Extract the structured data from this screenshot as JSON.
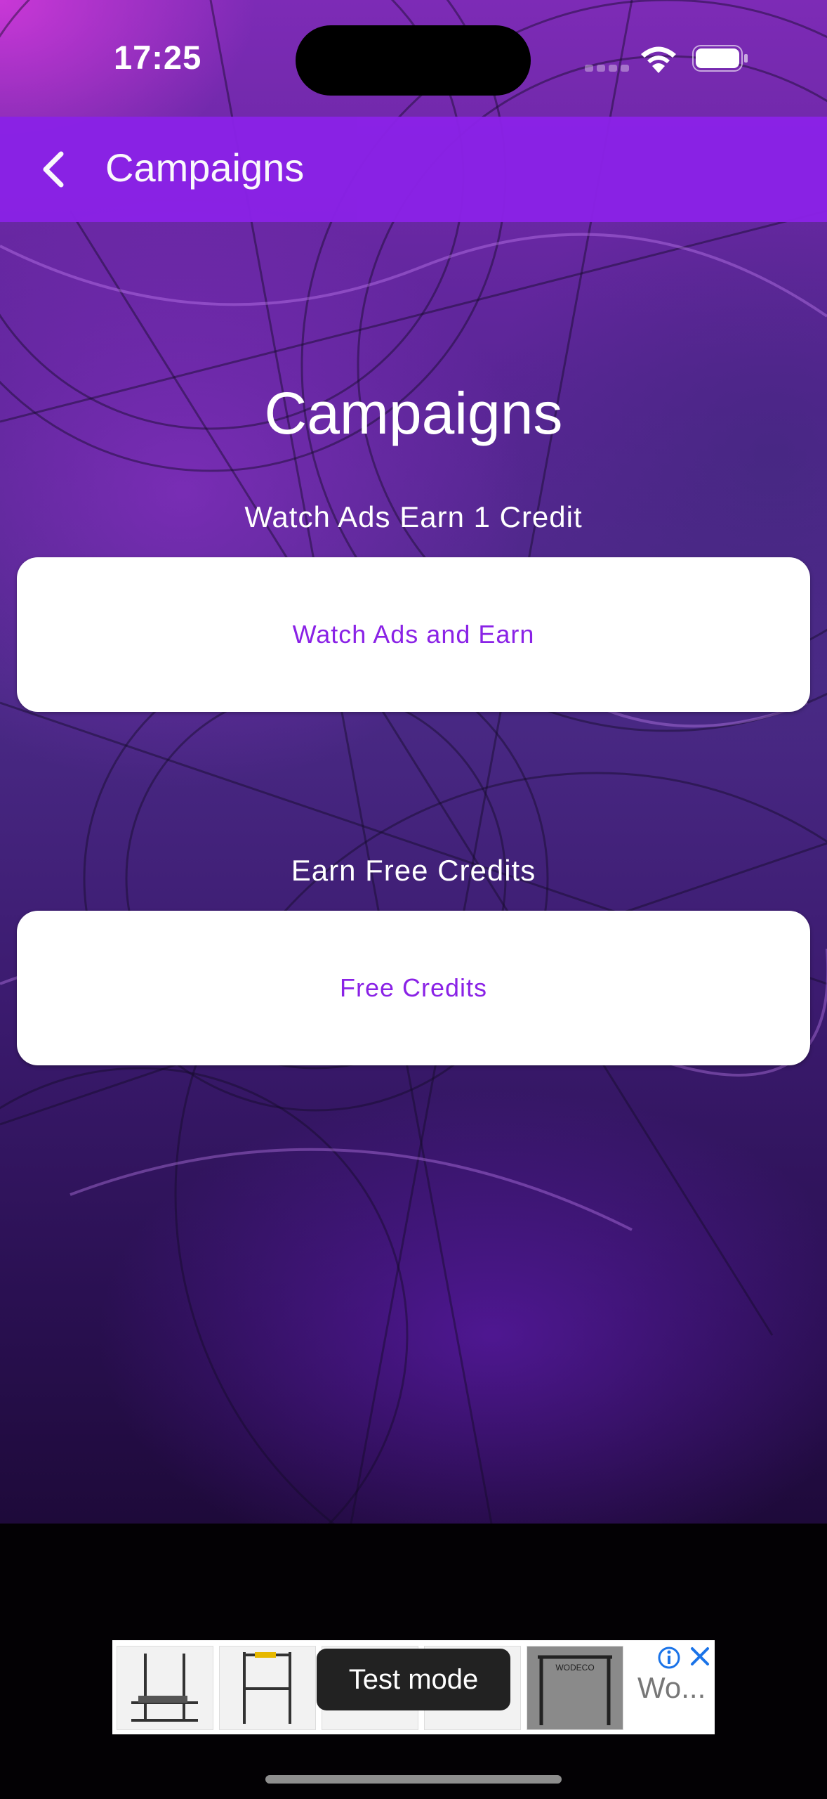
{
  "status_bar": {
    "time": "17:25"
  },
  "app_bar": {
    "title": "Campaigns",
    "back_icon": "chevron-left-icon"
  },
  "main": {
    "title": "Campaigns",
    "sections": [
      {
        "label": "Watch Ads Earn 1 Credit",
        "button_label": "Watch Ads and Earn"
      },
      {
        "label": "Earn Free Credits",
        "button_label": "Free Credits"
      }
    ]
  },
  "ad": {
    "overlay_label": "Test mode",
    "truncated_text": "Wo...",
    "brand_text": "WODECO"
  },
  "colors": {
    "accent": "#8a22e6",
    "card": "#ffffff"
  }
}
